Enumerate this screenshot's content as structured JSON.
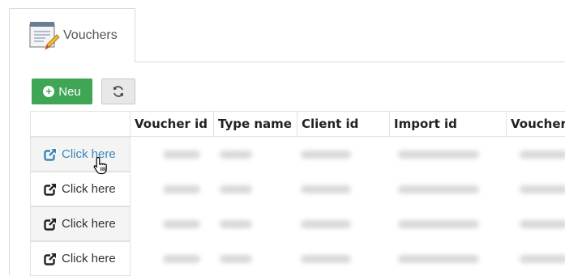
{
  "tab": {
    "label": "Vouchers"
  },
  "toolbar": {
    "new_label": "Neu"
  },
  "table": {
    "columns": [
      "",
      "Voucher id",
      "Type name",
      "Client id",
      "Import id",
      "Voucher"
    ],
    "rows": [
      {
        "link": "Click here"
      },
      {
        "link": "Click here"
      },
      {
        "link": "Click here"
      },
      {
        "link": "Click here"
      }
    ]
  },
  "colors": {
    "accent": "#3fa655",
    "link": "#3a87b8"
  }
}
